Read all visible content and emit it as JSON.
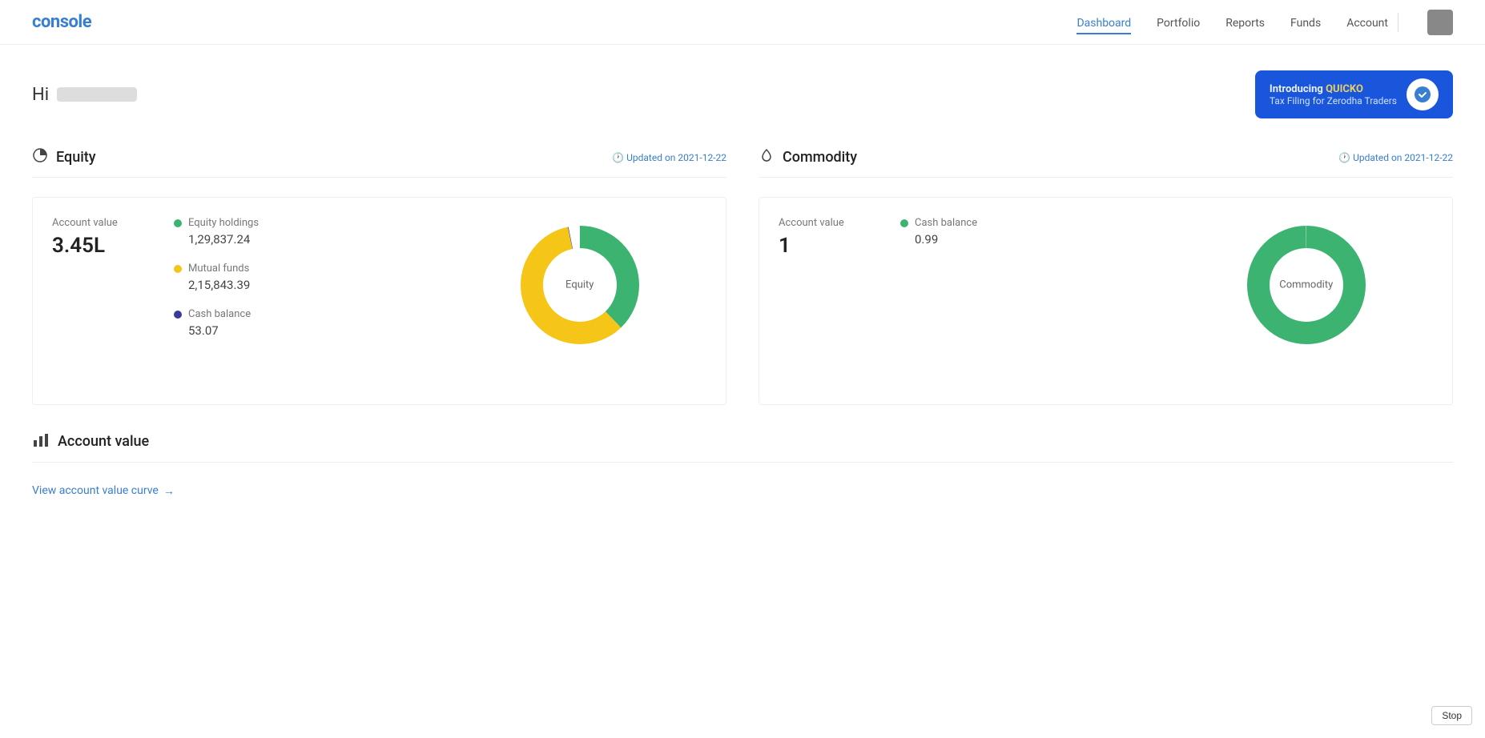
{
  "nav": {
    "logo": "console",
    "links": [
      {
        "label": "Dashboard",
        "active": true
      },
      {
        "label": "Portfolio",
        "active": false
      },
      {
        "label": "Reports",
        "active": false
      },
      {
        "label": "Funds",
        "active": false
      },
      {
        "label": "Account",
        "active": false
      }
    ]
  },
  "greeting": {
    "hi": "Hi"
  },
  "quicko": {
    "intro": "Introducing",
    "brand": "QUICKO",
    "subtitle": "Tax Filing for Zerodha Traders",
    "icon": "💙"
  },
  "equity": {
    "title": "Equity",
    "updated_label": "Updated on",
    "updated_date": "2021-12-22",
    "account_value_label": "Account value",
    "account_value": "3.45L",
    "legend": [
      {
        "label": "Equity holdings",
        "value": "1,29,837.24",
        "color": "#3cb371"
      },
      {
        "label": "Mutual funds",
        "value": "2,15,843.39",
        "color": "#f5c518"
      },
      {
        "label": "Cash balance",
        "value": "53.07",
        "color": "#3a3a9e"
      }
    ],
    "chart_label": "Equity"
  },
  "commodity": {
    "title": "Commodity",
    "updated_label": "Updated on",
    "updated_date": "2021-12-22",
    "account_value_label": "Account value",
    "account_value": "1",
    "legend": [
      {
        "label": "Cash balance",
        "value": "0.99",
        "color": "#3cb371"
      }
    ],
    "chart_label": "Commodity"
  },
  "account_value_section": {
    "icon": "📊",
    "title": "Account value",
    "view_curve": "View account value curve",
    "arrow": "→"
  },
  "stop_btn": "Stop"
}
